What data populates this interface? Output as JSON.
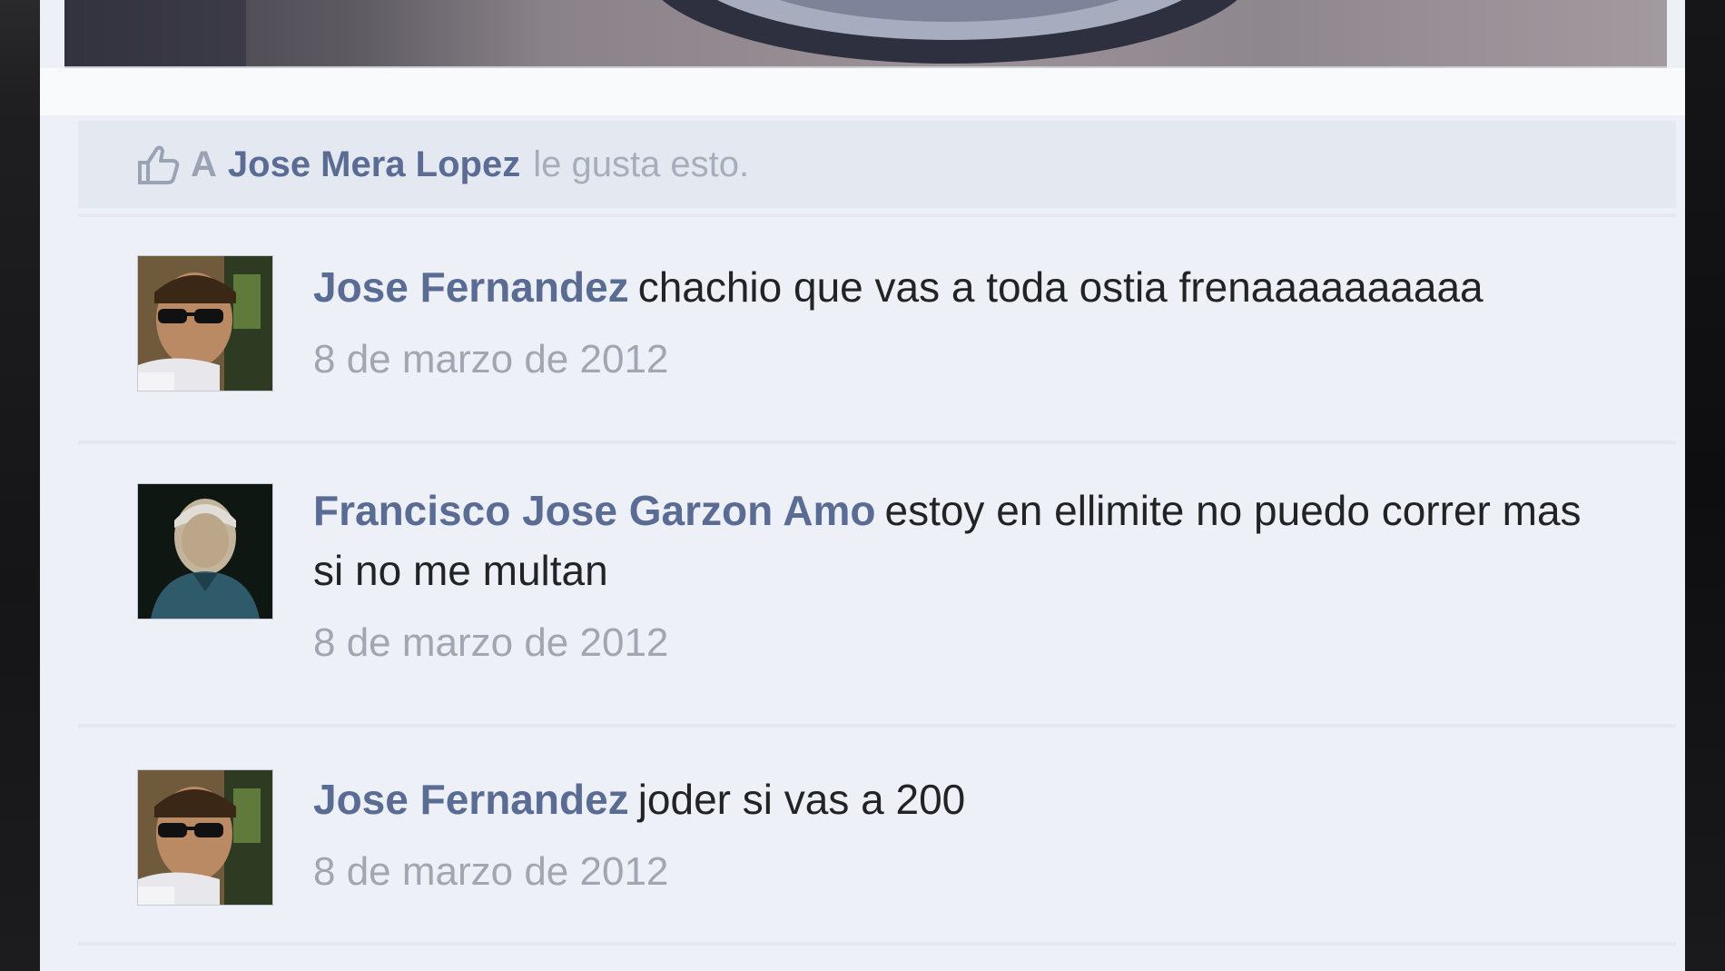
{
  "likes": {
    "prefix": "A",
    "liker": "Jose Mera Lopez",
    "suffix": "le gusta esto."
  },
  "comments": [
    {
      "author": "Jose Fernandez",
      "text": "chachio que vas a toda ostia frenaaaaaaaaaa",
      "date": "8 de marzo de 2012",
      "avatar_icon": "profile-photo-sunglasses"
    },
    {
      "author": "Francisco Jose Garzon Amo",
      "text": "estoy en ellimite no puedo correr mas si no me multan",
      "date": "8 de marzo de 2012",
      "avatar_icon": "profile-photo-older-man"
    },
    {
      "author": "Jose Fernandez",
      "text": "joder si vas a 200",
      "date": "8 de marzo de 2012",
      "avatar_icon": "profile-photo-sunglasses"
    }
  ],
  "colors": {
    "author_link": "#5a6b94",
    "comment_text": "#222325",
    "timestamp": "#a1a6b0",
    "card_background": "#edf0f6",
    "likes_background": "#e4e8f1"
  }
}
